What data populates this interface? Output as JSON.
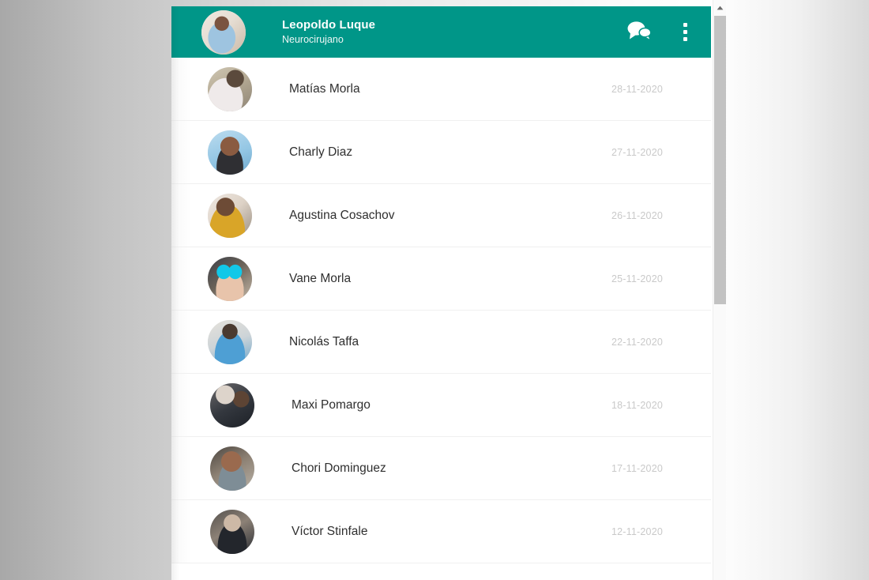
{
  "header": {
    "name": "Leopoldo Luque",
    "role": "Neurocirujano",
    "avatar_icon": "profile-photo",
    "chat_icon": "chat-bubbles-icon",
    "menu_icon": "kebab-menu-icon",
    "background_color": "#009688"
  },
  "scrollbar": {
    "up_arrow_icon": "scroll-up-arrow-icon"
  },
  "contacts": [
    {
      "name": "Matías Morla",
      "date": "28-11-2020"
    },
    {
      "name": "Charly Diaz",
      "date": "27-11-2020"
    },
    {
      "name": "Agustina Cosachov",
      "date": "26-11-2020"
    },
    {
      "name": "Vane Morla",
      "date": "25-11-2020"
    },
    {
      "name": "Nicolás Taffa",
      "date": "22-11-2020"
    },
    {
      "name": "Maxi Pomargo",
      "date": "18-11-2020"
    },
    {
      "name": "Chori Dominguez",
      "date": "17-11-2020"
    },
    {
      "name": "Víctor Stinfale",
      "date": "12-11-2020"
    }
  ]
}
